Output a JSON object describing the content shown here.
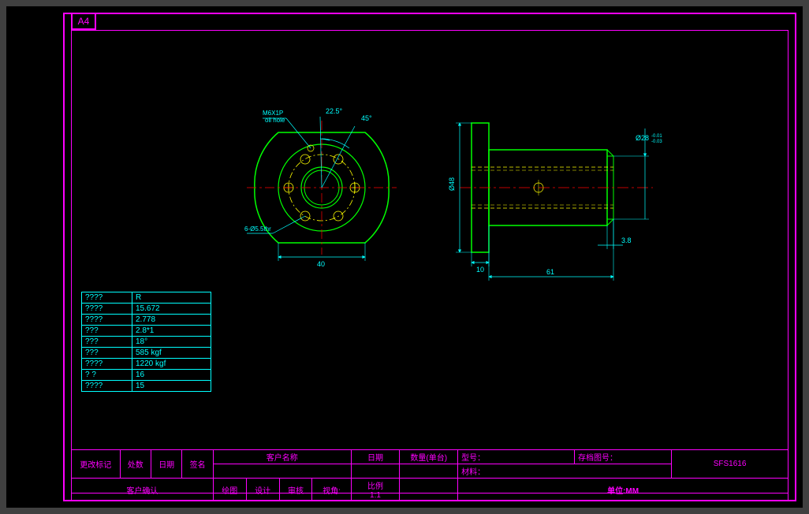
{
  "sheet_size": "A4",
  "drawing": {
    "oil_hole_label": "M6X1P",
    "oil_hole_sub": "oil hole",
    "angle1": "22.5°",
    "angle2": "45°",
    "hole_callout": "6-Ø5.5thr",
    "dim_40": "40",
    "dim_48": "Ø48",
    "dim_28": "Ø28",
    "dim_28_tol_top": "-0.01",
    "dim_28_tol_bot": "-0.03",
    "dim_10": "10",
    "dim_3_8": "3.8",
    "dim_61": "61"
  },
  "spec_table": {
    "rows": [
      {
        "label": "????",
        "value": "R"
      },
      {
        "label": "????",
        "value": "15.672"
      },
      {
        "label": "????",
        "value": "2.778"
      },
      {
        "label": "???",
        "value": "2.8*1"
      },
      {
        "label": "???",
        "value": "18°"
      },
      {
        "label": "???",
        "value": "585 kgf"
      },
      {
        "label": "????",
        "value": "1220 kgf"
      },
      {
        "label": "?  ?",
        "value": "16"
      },
      {
        "label": "????",
        "value": "15"
      }
    ]
  },
  "title_block": {
    "change_mark": "更改标记",
    "place": "处数",
    "date": "日期",
    "sign": "签名",
    "client_confirm": "客户确认",
    "client_name": "客户名称",
    "date2": "日期",
    "qty": "数量(单台)",
    "model": "型号：",
    "material": "材料：",
    "archive": "存档图号：",
    "archive_no": "SFS1616",
    "draw": "绘图",
    "design": "设计",
    "review": "审核",
    "view": "视角:",
    "scale": "比例",
    "scale_val": "1:1",
    "unit_label": "单位:MM"
  }
}
